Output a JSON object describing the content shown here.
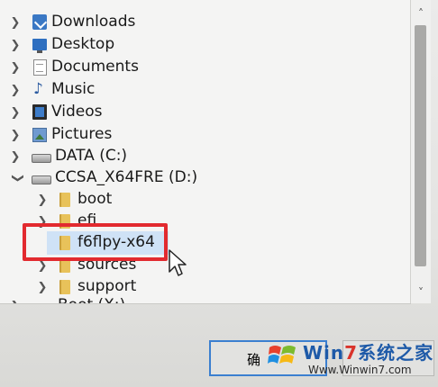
{
  "tree": {
    "items": [
      {
        "label": "Downloads",
        "icon": "download-folder-icon"
      },
      {
        "label": "Desktop",
        "icon": "desktop-folder-icon"
      },
      {
        "label": "Documents",
        "icon": "documents-folder-icon"
      },
      {
        "label": "Music",
        "icon": "music-folder-icon"
      },
      {
        "label": "Videos",
        "icon": "videos-folder-icon"
      },
      {
        "label": "Pictures",
        "icon": "pictures-folder-icon"
      },
      {
        "label": "DATA (C:)",
        "icon": "drive-icon"
      },
      {
        "label": "CCSA_X64FRE (D:)",
        "icon": "drive-icon",
        "expanded": true
      },
      {
        "label": "boot",
        "icon": "folder-icon"
      },
      {
        "label": "efi",
        "icon": "folder-icon"
      },
      {
        "label": "f6flpy-x64",
        "icon": "folder-icon",
        "selected": true
      },
      {
        "label": "sources",
        "icon": "folder-icon"
      },
      {
        "label": "support",
        "icon": "folder-icon"
      },
      {
        "label": "Boot (X:)",
        "icon": "drive-icon"
      }
    ]
  },
  "buttons": {
    "ok_label": "确",
    "cancel_label": ""
  },
  "watermark": {
    "brand_a": "Win",
    "brand_b": "7",
    "brand_c": "系统之家",
    "url": "Www.Winwin7.com"
  },
  "colors": {
    "highlight": "#e22a2f",
    "selection": "#cfe2f6",
    "folder": "#e8c25a"
  }
}
